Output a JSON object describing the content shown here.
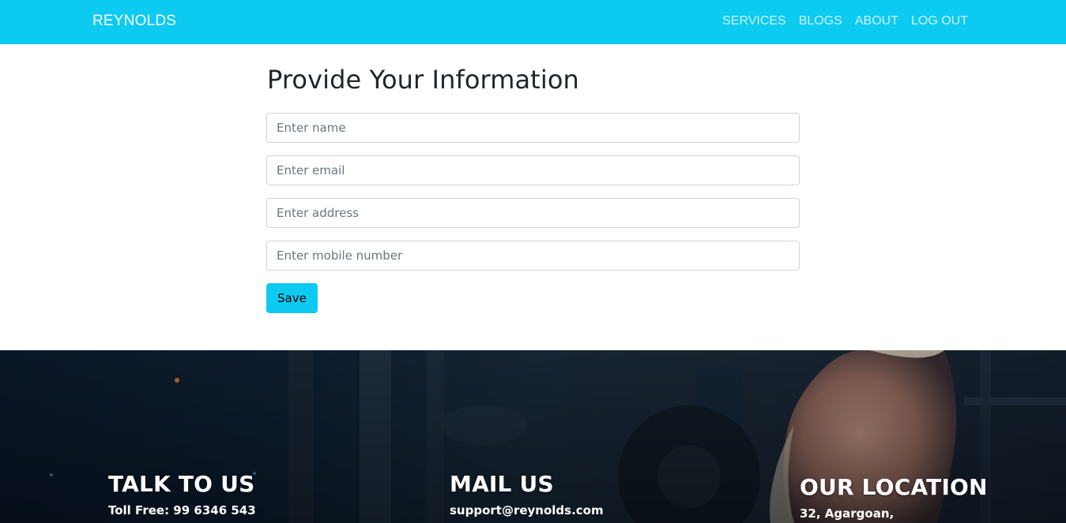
{
  "navbar": {
    "brand": "REYNOLDS",
    "links": [
      "SERVICES",
      "BLOGS",
      "ABOUT",
      "LOG OUT"
    ]
  },
  "form": {
    "title": "Provide Your Information",
    "fields": {
      "name": {
        "placeholder": "Enter name",
        "value": ""
      },
      "email": {
        "placeholder": "Enter email",
        "value": ""
      },
      "address": {
        "placeholder": "Enter address",
        "value": ""
      },
      "mobile": {
        "placeholder": "Enter mobile number",
        "value": ""
      }
    },
    "save_label": "Save"
  },
  "footer": {
    "talk": {
      "heading": "TALK TO US",
      "text": "Toll Free: 99 6346 543"
    },
    "mail": {
      "heading": "MAIL US",
      "text": "support@reynolds.com"
    },
    "location": {
      "heading": "OUR LOCATION",
      "text": "32, Agargoan,"
    },
    "background_icon": "gym-weightlifter-photo"
  },
  "colors": {
    "accent": "#0dcaf0",
    "title_text": "#212529",
    "footer_bg": "#0f2236"
  }
}
